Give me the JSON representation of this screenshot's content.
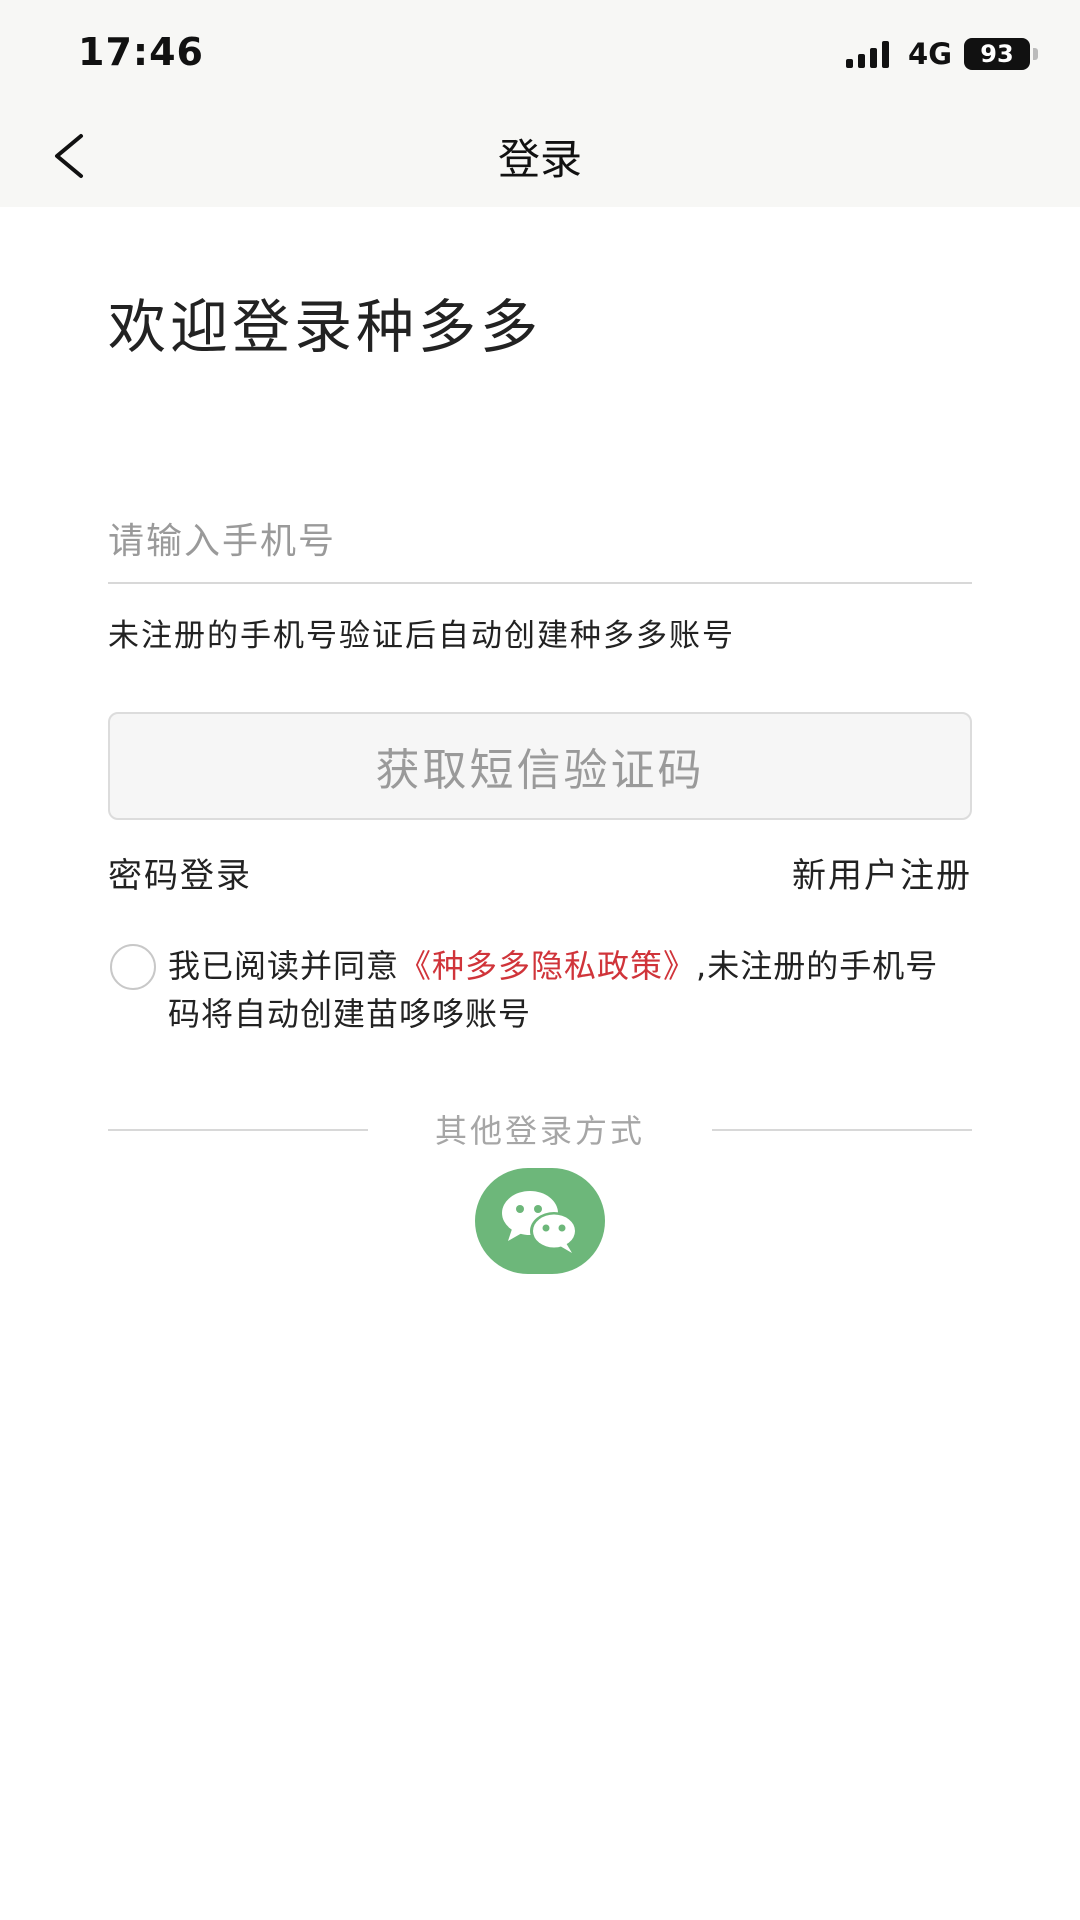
{
  "status": {
    "time": "17:46",
    "network": "4G",
    "battery": "93"
  },
  "nav": {
    "title": "登录"
  },
  "main": {
    "welcome": "欢迎登录种多多",
    "phone_placeholder": "请输入手机号",
    "phone_hint": "未注册的手机号验证后自动创建种多多账号",
    "sms_button": "获取短信验证码",
    "password_login": "密码登录",
    "register": "新用户注册",
    "agreement_prefix": "我已阅读并同意",
    "agreement_link": "《种多多隐私政策》",
    "agreement_suffix": ",未注册的手机号码将自动创建苗哆哆账号"
  },
  "other_login": {
    "label": "其他登录方式"
  },
  "colors": {
    "link_red": "#d0343a",
    "wechat_green": "#6db77a"
  }
}
